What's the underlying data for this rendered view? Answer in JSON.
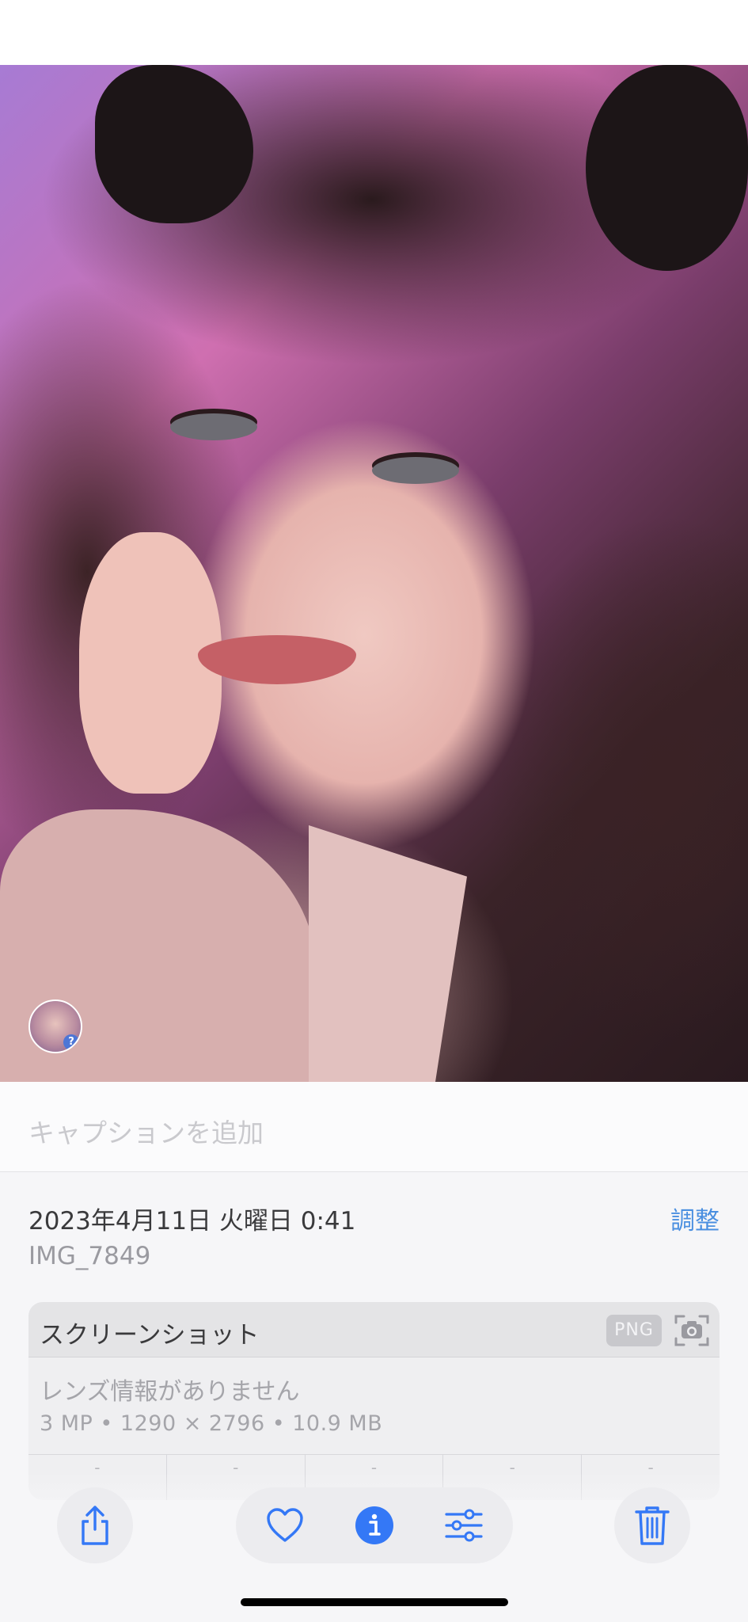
{
  "caption": {
    "placeholder": "キャプションを追加"
  },
  "photo_info": {
    "datetime": "2023年4月11日 火曜日 0:41",
    "adjust_label": "調整",
    "filename": "IMG_7849"
  },
  "metadata_card": {
    "title": "スクリーンショット",
    "format_badge": "PNG",
    "lens_info": "レンズ情報がありません",
    "specs": "3 MP • 1290 × 2796 • 10.9 MB",
    "exif_values": [
      "-",
      "-",
      "-",
      "-",
      "-"
    ]
  },
  "live_badge": {
    "symbol": "?"
  },
  "toolbar": {
    "share_icon": "share-icon",
    "favorite_icon": "heart-icon",
    "info_icon": "info-icon",
    "edit_icon": "sliders-icon",
    "delete_icon": "trash-icon"
  },
  "colors": {
    "accent": "#4a8fe0",
    "toolbar_icon": "#3478f6"
  }
}
